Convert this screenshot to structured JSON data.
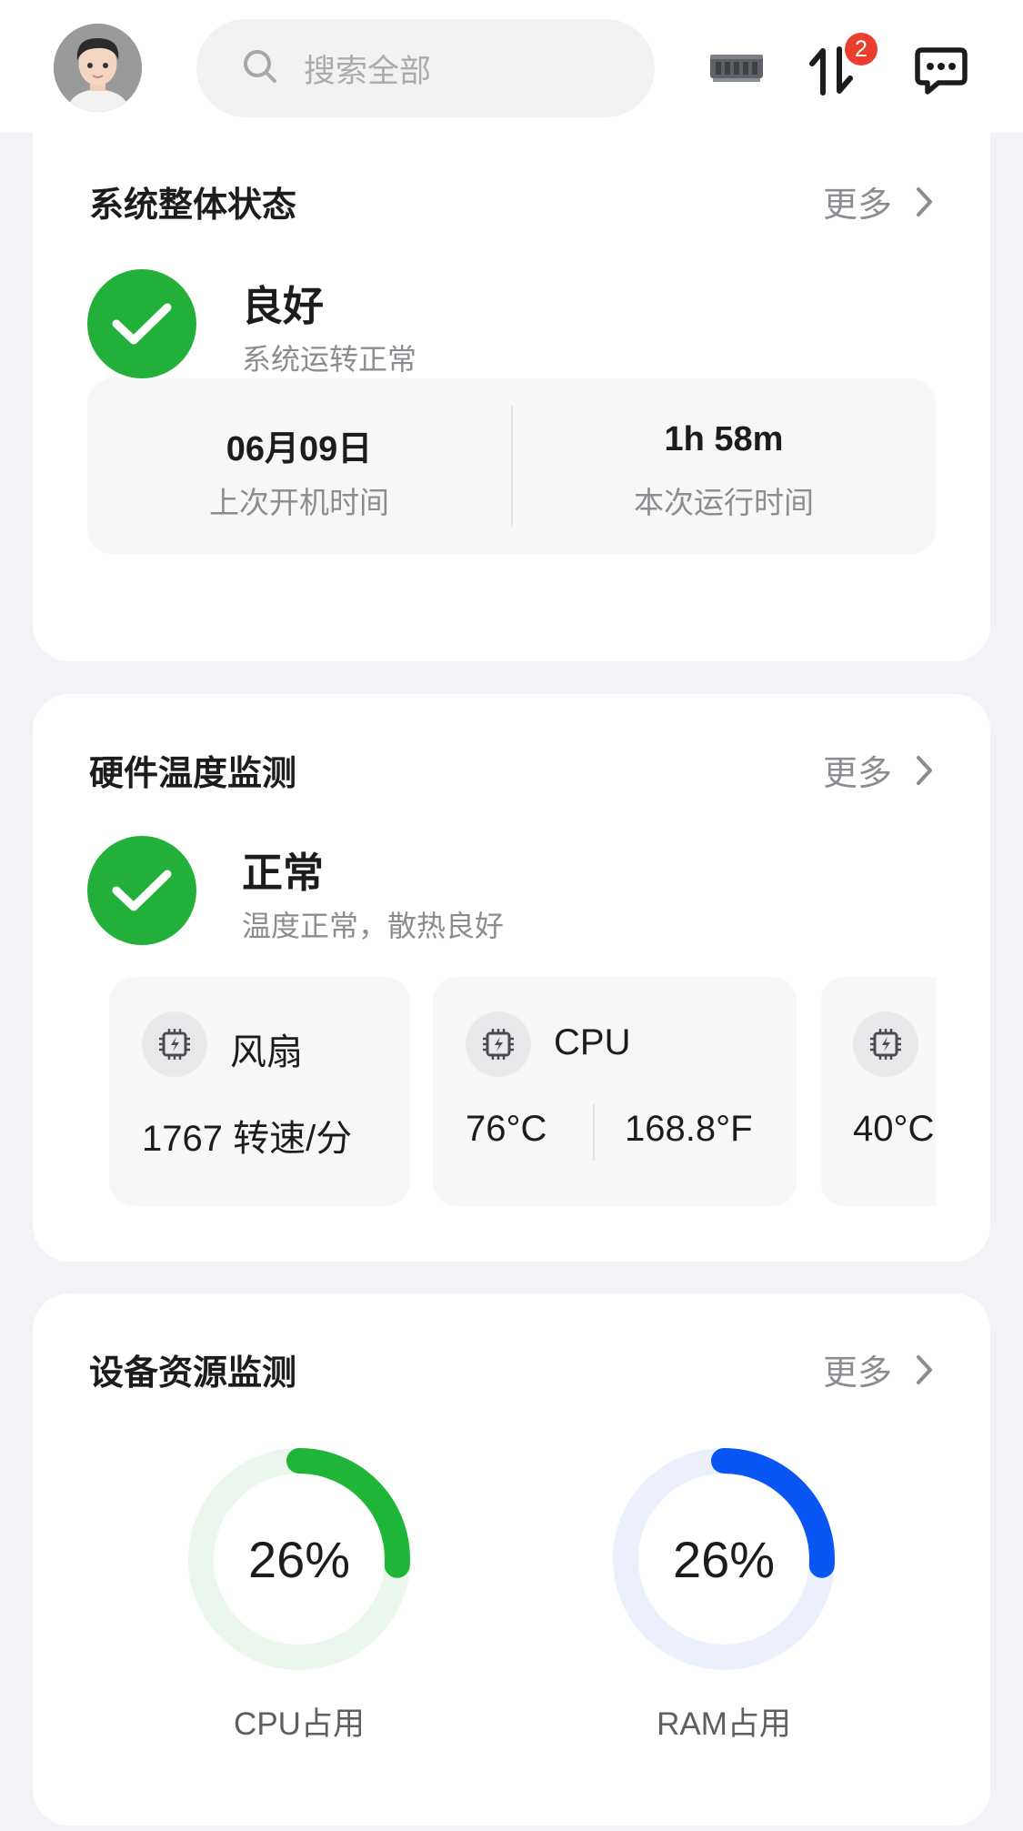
{
  "header": {
    "search_placeholder": "搜索全部",
    "transfer_badge_count": "2",
    "icons": [
      "avatar",
      "search-icon",
      "nas-device-icon",
      "transfer-icon",
      "message-icon"
    ]
  },
  "system_status": {
    "title": "系统整体状态",
    "more": "更多",
    "status": "良好",
    "status_desc": "系统运转正常",
    "last_boot_value": "06月09日",
    "last_boot_label": "上次开机时间",
    "uptime_value": "1h 58m",
    "uptime_label": "本次运行时间"
  },
  "hardware_temp": {
    "title": "硬件温度监测",
    "more": "更多",
    "status": "正常",
    "status_desc": "温度正常，散热良好",
    "tiles": [
      {
        "name": "风扇",
        "value": "1767 转速/分"
      },
      {
        "name": "CPU",
        "celsius": "76°C",
        "fahrenheit": "168.8°F"
      },
      {
        "name": "",
        "celsius": "40°C"
      }
    ]
  },
  "resources": {
    "title": "设备资源监测",
    "more": "更多",
    "cpu": {
      "percent": 26,
      "percent_text": "26%",
      "label": "CPU占用",
      "color": "#1fb538",
      "track": "#ebf6ed"
    },
    "ram": {
      "percent": 26,
      "percent_text": "26%",
      "label": "RAM占用",
      "color": "#0a56f5",
      "track": "#ebf0fc"
    }
  },
  "colors": {
    "ok_green": "#22b03a",
    "badge_red": "#ea3f2f"
  }
}
